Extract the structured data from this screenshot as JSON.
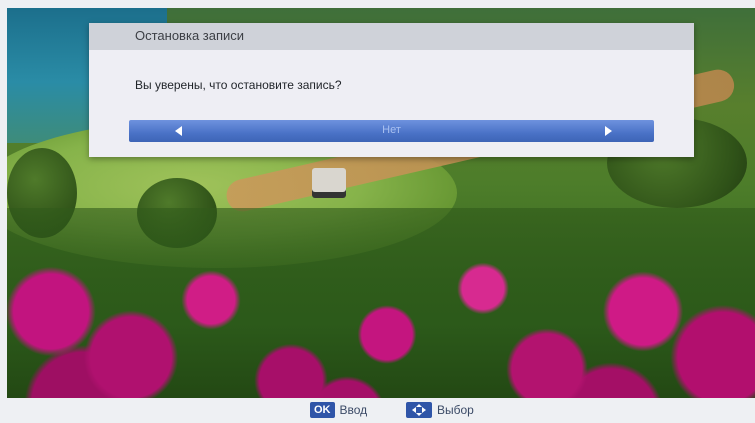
{
  "dialog": {
    "title": "Остановка записи",
    "message": "Вы уверены, что остановите запись?",
    "selected_option": "Нет"
  },
  "hints": [
    {
      "key": "OK",
      "label": "Ввод",
      "icon": "ok-key-icon"
    },
    {
      "key": "",
      "label": "Выбор",
      "icon": "dpad-icon"
    }
  ],
  "colors": {
    "dialog_bg": "#eeeef4",
    "title_bar": "#cfd2d9",
    "selection_bar": "#4a72c7",
    "key_badge": "#2f55a8"
  }
}
